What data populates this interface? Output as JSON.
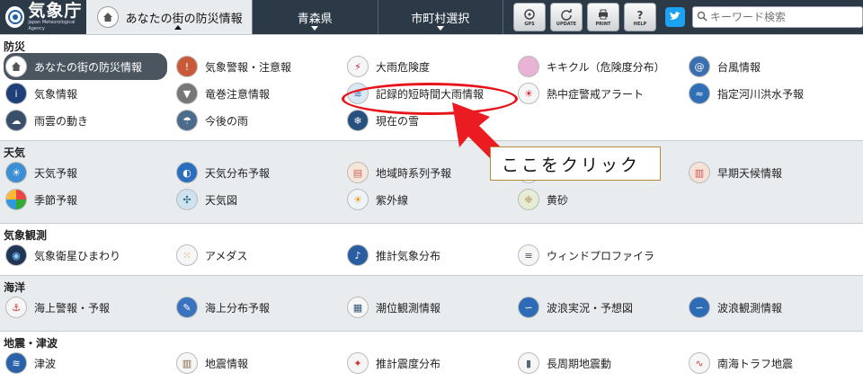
{
  "header": {
    "logo_name": "気象庁",
    "logo_sub": "Japan Meteorological Agency",
    "local_tab_label": "あなたの街の防災情報",
    "nav_tabs": [
      {
        "label": "青森県"
      },
      {
        "label": "市町村選択"
      }
    ],
    "tools": [
      {
        "icon": "gps-icon",
        "label": "GPS"
      },
      {
        "icon": "update-icon",
        "label": "UPDATE"
      },
      {
        "icon": "print-icon",
        "label": "PRINT"
      },
      {
        "icon": "help-icon",
        "label": "HELP"
      }
    ],
    "search_placeholder": "キーワード検索"
  },
  "sections": [
    {
      "title": "防災",
      "items": [
        {
          "label": "あなたの街の防災情報",
          "icon": "home-icon"
        },
        {
          "label": "気象警報・注意報",
          "icon": "warning-icon"
        },
        {
          "label": "大雨危険度",
          "icon": "heavy-rain-risk-icon"
        },
        {
          "label": "キキクル（危険度分布）",
          "icon": "kikikuru-icon"
        },
        {
          "label": "台風情報",
          "icon": "typhoon-icon"
        },
        {
          "label": "気象情報",
          "icon": "info-icon"
        },
        {
          "label": "竜巻注意情報",
          "icon": "tornado-icon"
        },
        {
          "label": "記録的短時間大雨情報",
          "icon": "record-rain-icon"
        },
        {
          "label": "熱中症警戒アラート",
          "icon": "heatstroke-icon"
        },
        {
          "label": "指定河川洪水予報",
          "icon": "river-flood-icon"
        },
        {
          "label": "雨雲の動き",
          "icon": "rain-cloud-icon"
        },
        {
          "label": "今後の雨",
          "icon": "future-rain-icon"
        },
        {
          "label": "現在の雪",
          "icon": "snow-icon"
        }
      ]
    },
    {
      "title": "天気",
      "items": [
        {
          "label": "天気予報",
          "icon": "weather-forecast-icon"
        },
        {
          "label": "天気分布予報",
          "icon": "weather-distribution-icon"
        },
        {
          "label": "地域時系列予報",
          "icon": "time-series-icon"
        },
        {
          "label": "",
          "icon": "hidden-item-icon"
        },
        {
          "label": "早期天候情報",
          "icon": "early-weather-icon"
        },
        {
          "label": "季節予報",
          "icon": "seasonal-forecast-icon"
        },
        {
          "label": "天気図",
          "icon": "weather-map-icon"
        },
        {
          "label": "紫外線",
          "icon": "uv-icon"
        },
        {
          "label": "黄砂",
          "icon": "yellow-sand-icon"
        }
      ]
    },
    {
      "title": "気象観測",
      "items": [
        {
          "label": "気象衛星ひまわり",
          "icon": "satellite-icon"
        },
        {
          "label": "アメダス",
          "icon": "amedas-icon"
        },
        {
          "label": "推計気象分布",
          "icon": "estimated-weather-icon"
        },
        {
          "label": "ウィンドプロファイラ",
          "icon": "wind-profiler-icon"
        }
      ]
    },
    {
      "title": "海洋",
      "items": [
        {
          "label": "海上警報・予報",
          "icon": "marine-warning-icon"
        },
        {
          "label": "海上分布予報",
          "icon": "marine-distribution-icon"
        },
        {
          "label": "潮位観測情報",
          "icon": "tide-icon"
        },
        {
          "label": "波浪実況・予想図",
          "icon": "wave-chart-icon"
        },
        {
          "label": "波浪観測情報",
          "icon": "wave-observation-icon"
        }
      ]
    },
    {
      "title": "地震・津波",
      "items": [
        {
          "label": "津波",
          "icon": "tsunami-icon"
        },
        {
          "label": "地震情報",
          "icon": "earthquake-icon"
        },
        {
          "label": "推計震度分布",
          "icon": "intensity-distribution-icon"
        },
        {
          "label": "長周期地震動",
          "icon": "long-period-icon"
        },
        {
          "label": "南海トラフ地震",
          "icon": "nankai-trough-icon"
        }
      ]
    }
  ],
  "annotation": {
    "callout_text": "ここをクリック",
    "color": "#e8141b"
  },
  "colors": {
    "header_bg": "#2c3a48",
    "active_bg": "#4a5560",
    "section_bg": "#e9ecef"
  }
}
